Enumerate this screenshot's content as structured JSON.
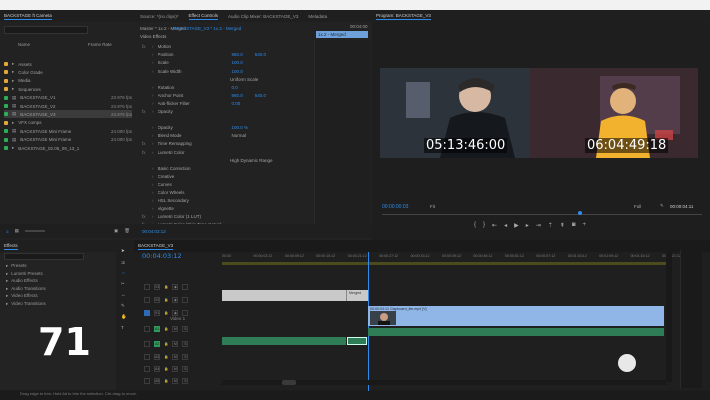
{
  "colors": {
    "accent_blue": "#2d8ceb",
    "clip_blue": "#8fb6e6",
    "clip_gray": "#c9c9c9",
    "audio_green": "#2f7d57",
    "panel_bg": "#232323"
  },
  "project": {
    "title": "BACKSTAGE ft Cameta",
    "columns": {
      "name": "Name",
      "fps": "Frame Rate"
    },
    "items": [
      {
        "name": "Assets",
        "fps": "",
        "color": "#e0a73a"
      },
      {
        "name": "Color Grade",
        "fps": "",
        "color": "#e0a73a"
      },
      {
        "name": "Media",
        "fps": "",
        "color": "#e0a73a"
      },
      {
        "name": "Sequences",
        "fps": "",
        "color": "#e0a73a"
      },
      {
        "name": "BACKSTAGE_V1",
        "fps": "23.976 fps",
        "color": "#2fae58"
      },
      {
        "name": "BACKSTAGE_V2",
        "fps": "23.976 fps",
        "color": "#2fae58"
      },
      {
        "name": "BACKSTAGE_V3",
        "fps": "23.976 fps",
        "color": "#2fae58"
      },
      {
        "name": "VFX comps",
        "fps": "",
        "color": "#e0a73a"
      },
      {
        "name": "BACKSTAGE Mini Frame",
        "fps": "24.000 fps",
        "color": "#2fae58"
      },
      {
        "name": "BACKSTAGE Mini Frame",
        "fps": "24.000 fps",
        "color": "#2fae58"
      },
      {
        "name": "BACKSTAGE_02.05_09_13_1",
        "fps": "",
        "color": "#2fae58"
      }
    ]
  },
  "effect_controls": {
    "tabs": [
      "Source: *(no clips)*",
      "Effect Controls",
      "Audio Clip Mixer: BACKSTAGE_V3",
      "Metadata"
    ],
    "source_label": "Master * 1x.2 - Merged",
    "clip_label": "BACKSTAGE_V3 * 1x.2 - Merged",
    "timecode": "00:04:00",
    "clip_tag": "1x.2 - Merged",
    "section": "Video Effects",
    "rows": [
      {
        "label": "Motion",
        "v1": "",
        "v2": "",
        "fx": "fx"
      },
      {
        "label": "Position",
        "v1": "960.0",
        "v2": "540.0",
        "fx": ""
      },
      {
        "label": "Scale",
        "v1": "100.0",
        "v2": "",
        "fx": ""
      },
      {
        "label": "Scale Width",
        "v1": "100.0",
        "v2": "",
        "fx": ""
      },
      {
        "label": "",
        "v1": "Uniform Scale",
        "v2": "",
        "fx": ""
      },
      {
        "label": "Rotation",
        "v1": "0.0",
        "v2": "",
        "fx": ""
      },
      {
        "label": "Anchor Point",
        "v1": "960.0",
        "v2": "540.0",
        "fx": ""
      },
      {
        "label": "Anti-flicker Filter",
        "v1": "0.00",
        "v2": "",
        "fx": ""
      },
      {
        "label": "Opacity",
        "v1": "",
        "v2": "",
        "fx": "fx"
      },
      {
        "label": "",
        "v1": "",
        "v2": "",
        "fx": ""
      },
      {
        "label": "Opacity",
        "v1": "100.0 %",
        "v2": "",
        "fx": ""
      },
      {
        "label": "Blend Mode",
        "v1": "Normal",
        "v2": "",
        "fx": ""
      },
      {
        "label": "Time Remapping",
        "v1": "",
        "v2": "",
        "fx": "fx"
      },
      {
        "label": "Lumetri Color",
        "v1": "",
        "v2": "",
        "fx": "fx"
      },
      {
        "label": "",
        "v1": "High Dynamic Range",
        "v2": "",
        "fx": ""
      },
      {
        "label": "Basic Correction",
        "v1": "",
        "v2": "",
        "fx": ""
      },
      {
        "label": "Creative",
        "v1": "",
        "v2": "",
        "fx": ""
      },
      {
        "label": "Curves",
        "v1": "",
        "v2": "",
        "fx": ""
      },
      {
        "label": "Color Wheels",
        "v1": "",
        "v2": "",
        "fx": ""
      },
      {
        "label": "HSL Secondary",
        "v1": "",
        "v2": "",
        "fx": ""
      },
      {
        "label": "Vignette",
        "v1": "",
        "v2": "",
        "fx": ""
      },
      {
        "label": "Lumetri Color (1 LUT)",
        "v1": "",
        "v2": "",
        "fx": "fx"
      },
      {
        "label": "Lumetri Color (Skin Tone Setup)",
        "v1": "",
        "v2": "",
        "fx": "fx"
      }
    ],
    "footer_timecode": "00:04:03:12"
  },
  "program": {
    "title": "Program: BACKSTAGE_V3",
    "timecode_left": "00:00:00:03",
    "fit": "Fit",
    "quality": "Full",
    "timecode_right": "00:00:04:11",
    "overlay_left": "05:13:46:00",
    "overlay_right": "06:04:49:18"
  },
  "effects": {
    "title": "Effects",
    "items": [
      "Presets",
      "Lumetri Presets",
      "Audio Effects",
      "Audio Transitions",
      "Video Effects",
      "Video Transitions"
    ],
    "overlay_number": "71"
  },
  "timeline": {
    "title": "BACKSTAGE_V3",
    "timecode": "00:04:03:12",
    "ticks": [
      "00:00",
      "00:00:03:12",
      "00:00:09:12",
      "00:00:15:12",
      "00:00:21:12",
      "00:00:27:12",
      "00:00:33:12",
      "00:00:39:12",
      "00:00:45:12",
      "00:00:51:12",
      "00:00:57:12",
      "00:01:03:12",
      "00:01:09:12",
      "00:01:15:12",
      "00:01:21:12"
    ],
    "tracks": [
      {
        "name": "V3",
        "kind": "video"
      },
      {
        "name": "V2",
        "kind": "video"
      },
      {
        "name": "V1",
        "kind": "video"
      },
      {
        "name": "A1",
        "kind": "audio"
      },
      {
        "name": "A2",
        "kind": "audio"
      },
      {
        "name": "A3",
        "kind": "audio"
      },
      {
        "name": "A4",
        "kind": "audio"
      },
      {
        "name": "A5",
        "kind": "audio"
      }
    ],
    "track_labels": [
      "Video 1",
      "Audio 1"
    ],
    "clip_labels": {
      "merged": "Merged",
      "vfx": "00:00:03:12  Clapboard_lite.mp4 [V]"
    }
  },
  "status": {
    "hint": "Drag edge to trim. Hold Alt to trim the selection. Ctrl-drag to move."
  }
}
